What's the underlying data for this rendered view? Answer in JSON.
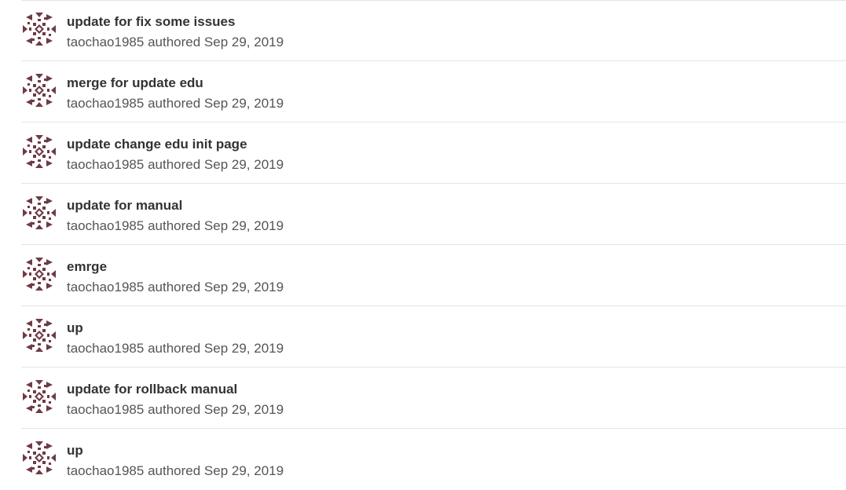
{
  "colors": {
    "avatar": "#6e3b45",
    "divider": "#e5e5e5",
    "title": "#333333",
    "meta": "#555555"
  },
  "commits": [
    {
      "title": "update for fix some issues",
      "author": "taochao1985",
      "verb": "authored",
      "date": "Sep 29, 2019",
      "avatar_icon": "identicon-avatar"
    },
    {
      "title": "merge for update edu",
      "author": "taochao1985",
      "verb": "authored",
      "date": "Sep 29, 2019",
      "avatar_icon": "identicon-avatar"
    },
    {
      "title": "update change edu init page",
      "author": "taochao1985",
      "verb": "authored",
      "date": "Sep 29, 2019",
      "avatar_icon": "identicon-avatar"
    },
    {
      "title": "update for manual",
      "author": "taochao1985",
      "verb": "authored",
      "date": "Sep 29, 2019",
      "avatar_icon": "identicon-avatar"
    },
    {
      "title": "emrge",
      "author": "taochao1985",
      "verb": "authored",
      "date": "Sep 29, 2019",
      "avatar_icon": "identicon-avatar"
    },
    {
      "title": "up",
      "author": "taochao1985",
      "verb": "authored",
      "date": "Sep 29, 2019",
      "avatar_icon": "identicon-avatar"
    },
    {
      "title": "update for rollback manual",
      "author": "taochao1985",
      "verb": "authored",
      "date": "Sep 29, 2019",
      "avatar_icon": "identicon-avatar"
    },
    {
      "title": "up",
      "author": "taochao1985",
      "verb": "authored",
      "date": "Sep 29, 2019",
      "avatar_icon": "identicon-avatar"
    }
  ]
}
